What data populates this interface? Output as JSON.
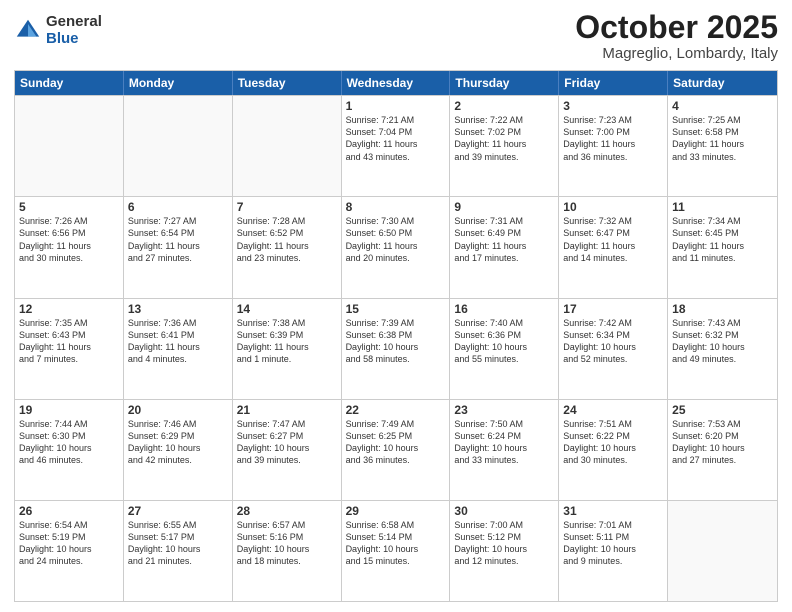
{
  "logo": {
    "general": "General",
    "blue": "Blue"
  },
  "title": "October 2025",
  "location": "Magreglio, Lombardy, Italy",
  "days": [
    "Sunday",
    "Monday",
    "Tuesday",
    "Wednesday",
    "Thursday",
    "Friday",
    "Saturday"
  ],
  "rows": [
    [
      {
        "day": "",
        "info": ""
      },
      {
        "day": "",
        "info": ""
      },
      {
        "day": "",
        "info": ""
      },
      {
        "day": "1",
        "info": "Sunrise: 7:21 AM\nSunset: 7:04 PM\nDaylight: 11 hours\nand 43 minutes."
      },
      {
        "day": "2",
        "info": "Sunrise: 7:22 AM\nSunset: 7:02 PM\nDaylight: 11 hours\nand 39 minutes."
      },
      {
        "day": "3",
        "info": "Sunrise: 7:23 AM\nSunset: 7:00 PM\nDaylight: 11 hours\nand 36 minutes."
      },
      {
        "day": "4",
        "info": "Sunrise: 7:25 AM\nSunset: 6:58 PM\nDaylight: 11 hours\nand 33 minutes."
      }
    ],
    [
      {
        "day": "5",
        "info": "Sunrise: 7:26 AM\nSunset: 6:56 PM\nDaylight: 11 hours\nand 30 minutes."
      },
      {
        "day": "6",
        "info": "Sunrise: 7:27 AM\nSunset: 6:54 PM\nDaylight: 11 hours\nand 27 minutes."
      },
      {
        "day": "7",
        "info": "Sunrise: 7:28 AM\nSunset: 6:52 PM\nDaylight: 11 hours\nand 23 minutes."
      },
      {
        "day": "8",
        "info": "Sunrise: 7:30 AM\nSunset: 6:50 PM\nDaylight: 11 hours\nand 20 minutes."
      },
      {
        "day": "9",
        "info": "Sunrise: 7:31 AM\nSunset: 6:49 PM\nDaylight: 11 hours\nand 17 minutes."
      },
      {
        "day": "10",
        "info": "Sunrise: 7:32 AM\nSunset: 6:47 PM\nDaylight: 11 hours\nand 14 minutes."
      },
      {
        "day": "11",
        "info": "Sunrise: 7:34 AM\nSunset: 6:45 PM\nDaylight: 11 hours\nand 11 minutes."
      }
    ],
    [
      {
        "day": "12",
        "info": "Sunrise: 7:35 AM\nSunset: 6:43 PM\nDaylight: 11 hours\nand 7 minutes."
      },
      {
        "day": "13",
        "info": "Sunrise: 7:36 AM\nSunset: 6:41 PM\nDaylight: 11 hours\nand 4 minutes."
      },
      {
        "day": "14",
        "info": "Sunrise: 7:38 AM\nSunset: 6:39 PM\nDaylight: 11 hours\nand 1 minute."
      },
      {
        "day": "15",
        "info": "Sunrise: 7:39 AM\nSunset: 6:38 PM\nDaylight: 10 hours\nand 58 minutes."
      },
      {
        "day": "16",
        "info": "Sunrise: 7:40 AM\nSunset: 6:36 PM\nDaylight: 10 hours\nand 55 minutes."
      },
      {
        "day": "17",
        "info": "Sunrise: 7:42 AM\nSunset: 6:34 PM\nDaylight: 10 hours\nand 52 minutes."
      },
      {
        "day": "18",
        "info": "Sunrise: 7:43 AM\nSunset: 6:32 PM\nDaylight: 10 hours\nand 49 minutes."
      }
    ],
    [
      {
        "day": "19",
        "info": "Sunrise: 7:44 AM\nSunset: 6:30 PM\nDaylight: 10 hours\nand 46 minutes."
      },
      {
        "day": "20",
        "info": "Sunrise: 7:46 AM\nSunset: 6:29 PM\nDaylight: 10 hours\nand 42 minutes."
      },
      {
        "day": "21",
        "info": "Sunrise: 7:47 AM\nSunset: 6:27 PM\nDaylight: 10 hours\nand 39 minutes."
      },
      {
        "day": "22",
        "info": "Sunrise: 7:49 AM\nSunset: 6:25 PM\nDaylight: 10 hours\nand 36 minutes."
      },
      {
        "day": "23",
        "info": "Sunrise: 7:50 AM\nSunset: 6:24 PM\nDaylight: 10 hours\nand 33 minutes."
      },
      {
        "day": "24",
        "info": "Sunrise: 7:51 AM\nSunset: 6:22 PM\nDaylight: 10 hours\nand 30 minutes."
      },
      {
        "day": "25",
        "info": "Sunrise: 7:53 AM\nSunset: 6:20 PM\nDaylight: 10 hours\nand 27 minutes."
      }
    ],
    [
      {
        "day": "26",
        "info": "Sunrise: 6:54 AM\nSunset: 5:19 PM\nDaylight: 10 hours\nand 24 minutes."
      },
      {
        "day": "27",
        "info": "Sunrise: 6:55 AM\nSunset: 5:17 PM\nDaylight: 10 hours\nand 21 minutes."
      },
      {
        "day": "28",
        "info": "Sunrise: 6:57 AM\nSunset: 5:16 PM\nDaylight: 10 hours\nand 18 minutes."
      },
      {
        "day": "29",
        "info": "Sunrise: 6:58 AM\nSunset: 5:14 PM\nDaylight: 10 hours\nand 15 minutes."
      },
      {
        "day": "30",
        "info": "Sunrise: 7:00 AM\nSunset: 5:12 PM\nDaylight: 10 hours\nand 12 minutes."
      },
      {
        "day": "31",
        "info": "Sunrise: 7:01 AM\nSunset: 5:11 PM\nDaylight: 10 hours\nand 9 minutes."
      },
      {
        "day": "",
        "info": ""
      }
    ]
  ]
}
